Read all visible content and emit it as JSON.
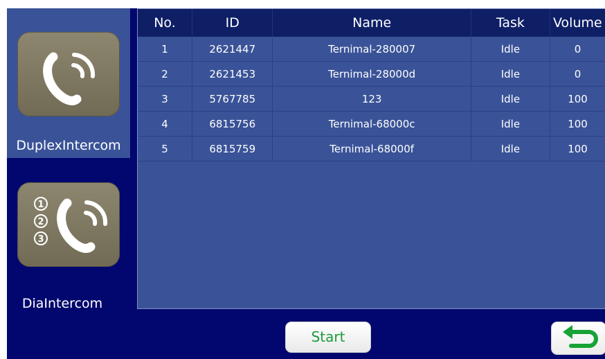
{
  "sidebar": {
    "items": [
      {
        "label": "DuplexIntercom",
        "icon": "phone-call-icon",
        "selected": true
      },
      {
        "label": "DiaIntercom",
        "icon": "numbered-phone-call-icon",
        "selected": false
      }
    ]
  },
  "table": {
    "columns": [
      "No.",
      "ID",
      "Name",
      "Task",
      "Volume"
    ],
    "rows": [
      [
        "1",
        "2621447",
        "Ternimal-280007",
        "Idle",
        "0"
      ],
      [
        "2",
        "2621453",
        "Ternimal-28000d",
        "Idle",
        "0"
      ],
      [
        "3",
        "5767785",
        "123",
        "Idle",
        "100"
      ],
      [
        "4",
        "6815756",
        "Ternimal-68000c",
        "Idle",
        "100"
      ],
      [
        "5",
        "6815759",
        "Ternimal-68000f",
        "Idle",
        "100"
      ]
    ]
  },
  "footer": {
    "start_label": "Start",
    "back_icon": "return-arrow-icon"
  },
  "colors": {
    "background": "#01076e",
    "panel": "#3a5398",
    "header": "#0e1f66",
    "tile": "#7f7a62",
    "start_text": "#1a9c3a",
    "back_arrow": "#17a335"
  }
}
